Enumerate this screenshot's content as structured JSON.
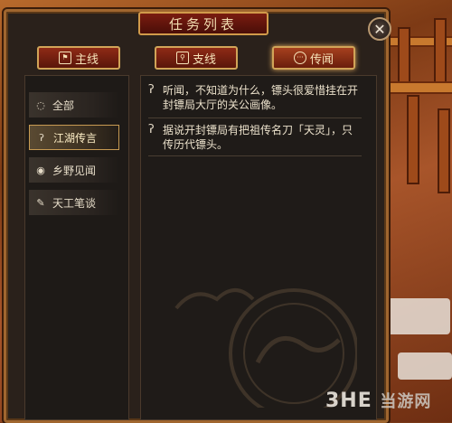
{
  "window": {
    "title": "任务列表",
    "close_symbol": "✕"
  },
  "tabs": [
    {
      "label": "主线",
      "icon": "flag-icon",
      "active": false
    },
    {
      "label": "支线",
      "icon": "search-icon",
      "active": false
    },
    {
      "label": "传闻",
      "icon": "speech-icon",
      "active": true
    }
  ],
  "categories": [
    {
      "label": "全部",
      "icon": "speech-icon",
      "active": false
    },
    {
      "label": "江湖传言",
      "icon": "ear-icon",
      "active": true
    },
    {
      "label": "乡野见闻",
      "icon": "eye-icon",
      "active": false
    },
    {
      "label": "天工笔谈",
      "icon": "brush-icon",
      "active": false
    }
  ],
  "rumors": [
    {
      "text": "听闻，不知道为什么，镖头很爱惜挂在开封镖局大厅的关公画像。"
    },
    {
      "text": "据说开封镖局有把祖传名刀「天灵」，只传历代镖头。"
    }
  ],
  "watermark": {
    "main": "3HE",
    "sub": "当游网"
  },
  "colors": {
    "accent": "#d1a458",
    "tab_red": "#8e2a16",
    "panel": "#1f1b18"
  }
}
